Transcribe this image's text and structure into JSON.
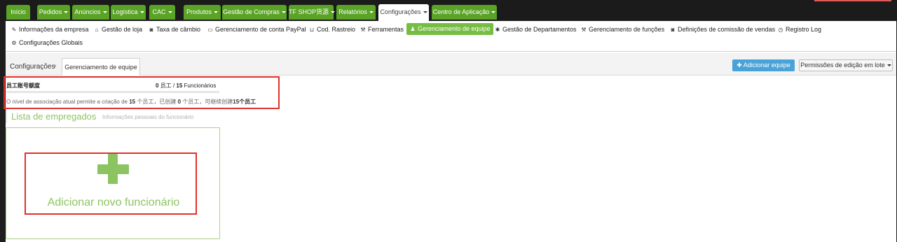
{
  "topnav": {
    "tabs": [
      {
        "label": "Início",
        "caret": false,
        "active": false
      },
      {
        "label": "Pedidos",
        "caret": true,
        "active": false
      },
      {
        "label": "Anúncios",
        "caret": true,
        "active": false
      },
      {
        "label": "Logística",
        "caret": true,
        "active": false
      },
      {
        "label": "CAC",
        "caret": true,
        "active": false
      },
      {
        "label": "Produtos",
        "caret": true,
        "active": false
      },
      {
        "label": "Gestão de Compras",
        "caret": true,
        "active": false
      },
      {
        "label": "TF SHOP货源",
        "caret": true,
        "active": false
      },
      {
        "label": "Relatórios",
        "caret": true,
        "active": false
      },
      {
        "label": "Configurações",
        "caret": true,
        "active": true
      },
      {
        "label": "Centro de Aplicação",
        "caret": true,
        "active": false
      }
    ]
  },
  "subnav": {
    "items": [
      {
        "label": "Informações da empresa",
        "icon": "edit-icon",
        "glyph": "✎",
        "active": false
      },
      {
        "label": "Gestão de loja",
        "icon": "home-icon",
        "glyph": "⌂",
        "active": false
      },
      {
        "label": "Taxa de câmbio",
        "icon": "camera-icon",
        "glyph": "◙",
        "active": false
      },
      {
        "label": "Gerenciamento de conta PayPal",
        "icon": "card-icon",
        "glyph": "▭",
        "active": false
      },
      {
        "label": "Cod. Rastreio",
        "icon": "inbox-icon",
        "glyph": "⊔",
        "active": false
      },
      {
        "label": "Ferramentas",
        "icon": "wrench-icon",
        "glyph": "⚒",
        "active": false
      },
      {
        "label": "Gerenciamento de equipe",
        "icon": "user-icon",
        "glyph": "♟",
        "active": true
      },
      {
        "label": "Gestão de Departamentos",
        "icon": "asterisk-icon",
        "glyph": "✱",
        "active": false
      },
      {
        "label": "Gerenciamento de funções",
        "icon": "wrench-icon",
        "glyph": "⚒",
        "active": false
      },
      {
        "label": "Definições de comissão de vendas",
        "icon": "camera-icon",
        "glyph": "◙",
        "active": false
      },
      {
        "label": "Registro Log",
        "icon": "clock-icon",
        "glyph": "◷",
        "active": false
      },
      {
        "label": "Configurações Globais",
        "icon": "gear-icon",
        "glyph": "⚙",
        "active": false
      }
    ]
  },
  "breadcrumb": {
    "root": "Configurações",
    "separator": "›",
    "current": "Gerenciamento de equipe"
  },
  "actions": {
    "add_team": "Adicionar equipe",
    "add_team_icon": "plus-icon",
    "batch_permissions": "Permissões de edição em lote"
  },
  "quota": {
    "title": "员工账号额度",
    "used": "0",
    "unit": "员工",
    "separator": "/",
    "total": "15",
    "total_label": "Funcionários",
    "fill_fraction": 0,
    "note_prefix": "O nível de associação atual permite a criação de",
    "note_limit": "15",
    "note_mid1": "个员工，已创建",
    "note_created": "0",
    "note_mid2": "个员工，可继续创建",
    "note_remaining": "15个员工"
  },
  "employee_list": {
    "title": "Lista de empregados",
    "subtitle": "Informações pessoais do funcionário",
    "add_card_label": "Adicionar novo funcionário",
    "add_card_icon": "plus-icon"
  },
  "colors": {
    "nav_green": "#5aa326",
    "active_green": "#76bd43",
    "accent_green": "#8dc462",
    "button_blue": "#4aa3d8",
    "highlight_red": "#e0312b"
  }
}
